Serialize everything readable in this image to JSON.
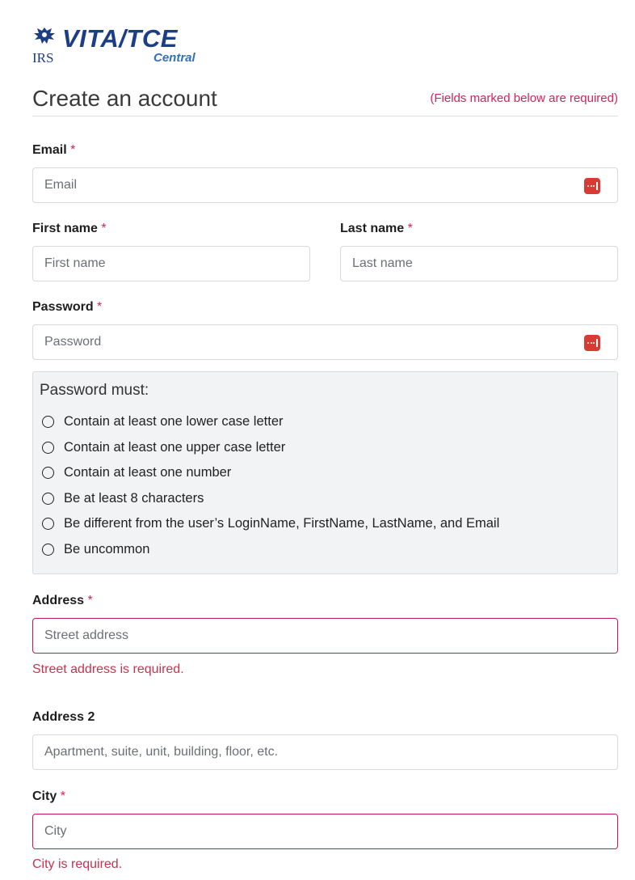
{
  "logo": {
    "agency": "IRS",
    "product": "VITA/TCE",
    "subtitle": "Central"
  },
  "page": {
    "title": "Create an account",
    "required_note": "(Fields marked below are required)"
  },
  "form": {
    "required_marker": "*",
    "email": {
      "label": "Email",
      "placeholder": "Email",
      "value": "",
      "icon": "password-manager-icon"
    },
    "first_name": {
      "label": "First name",
      "placeholder": "First name",
      "value": ""
    },
    "last_name": {
      "label": "Last name",
      "placeholder": "Last name",
      "value": ""
    },
    "password": {
      "label": "Password",
      "placeholder": "Password",
      "value": "",
      "icon": "password-manager-icon"
    },
    "password_rules": {
      "title": "Password must:",
      "items": [
        "Contain at least one lower case letter",
        "Contain at least one upper case letter",
        "Contain at least one number",
        "Be at least 8 characters",
        "Be different from the user’s LoginName, FirstName, LastName, and Email",
        "Be uncommon"
      ]
    },
    "address": {
      "label": "Address",
      "placeholder": "Street address",
      "value": "",
      "error": "Street address is required."
    },
    "address2": {
      "label": "Address 2",
      "placeholder": "Apartment, suite, unit, building, floor, etc.",
      "value": ""
    },
    "city": {
      "label": "City",
      "placeholder": "City",
      "value": "",
      "error": "City is required."
    }
  },
  "colors": {
    "brand": "#1c3e86",
    "required": "#d1245a",
    "error": "#c8334f",
    "invalid_border": "#c2185b",
    "password_manager_icon": "#d73b33"
  }
}
